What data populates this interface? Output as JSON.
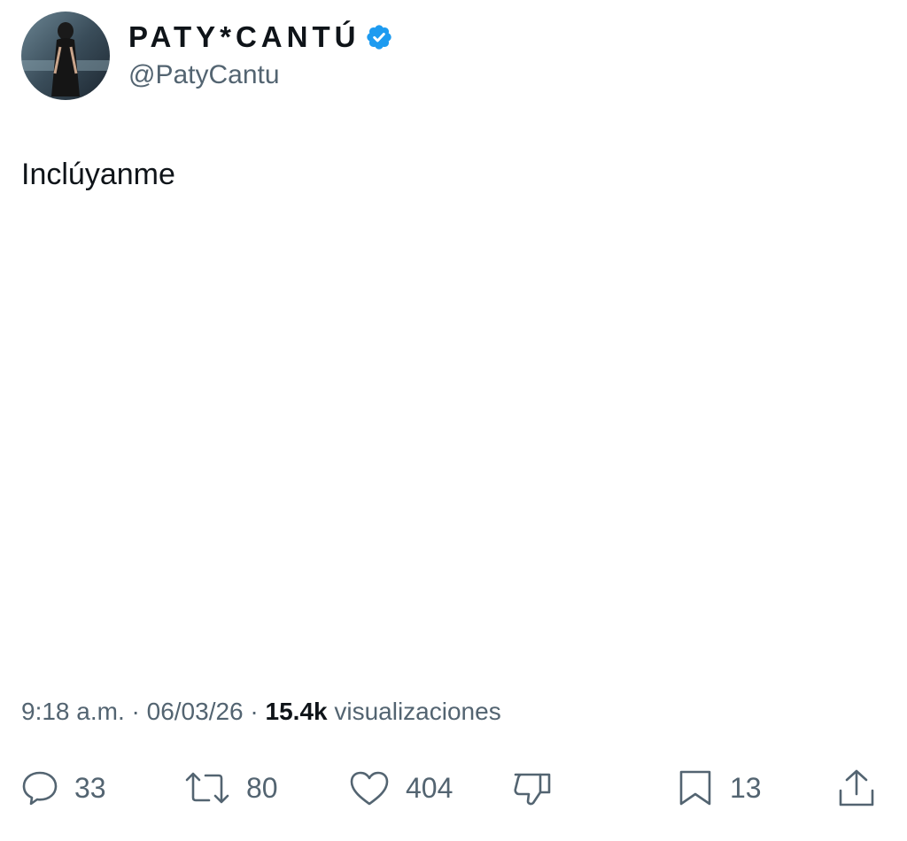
{
  "author": {
    "display_name": "PATY*CANTÚ",
    "handle": "@PatyCantu",
    "avatar_icon": "profile-photo",
    "verified_color": "#1d9bf0"
  },
  "tweet": {
    "text": "Inclúyanme"
  },
  "meta": {
    "time": "9:18 a.m.",
    "separator": " · ",
    "date": "06/03/26",
    "views_count": "15.4k",
    "views_label": " visualizaciones"
  },
  "actions": {
    "replies": "33",
    "reposts": "80",
    "likes": "404",
    "bookmarks": "13"
  },
  "colors": {
    "text": "#0f1419",
    "secondary": "#536471",
    "verified": "#1d9bf0"
  }
}
